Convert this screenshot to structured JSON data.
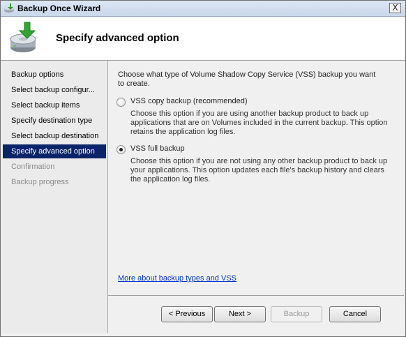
{
  "window": {
    "title": "Backup Once Wizard",
    "close_glyph": "X"
  },
  "header": {
    "heading": "Specify advanced option"
  },
  "steps": [
    {
      "label": "Backup options",
      "state": "normal"
    },
    {
      "label": "Select backup configur...",
      "state": "normal"
    },
    {
      "label": "Select backup items",
      "state": "normal"
    },
    {
      "label": "Specify destination type",
      "state": "normal"
    },
    {
      "label": "Select backup destination",
      "state": "normal"
    },
    {
      "label": "Specify advanced option",
      "state": "active"
    },
    {
      "label": "Confirmation",
      "state": "disabled"
    },
    {
      "label": "Backup progress",
      "state": "disabled"
    }
  ],
  "content": {
    "intro": "Choose what type of Volume Shadow Copy Service (VSS) backup you want to create.",
    "options": [
      {
        "label": "VSS copy backup (recommended)",
        "checked": false,
        "description": "Choose this option if you are using another backup product to back up applications that are on Volumes included in the current backup. This option retains the application log files."
      },
      {
        "label": "VSS full backup",
        "checked": true,
        "description": "Choose this option if you are not using any other backup product to back up your applications. This option updates each file's backup history and clears the application log files."
      }
    ],
    "link": "More about backup types and VSS"
  },
  "buttons": {
    "previous": "< Previous",
    "next": "Next >",
    "backup": "Backup",
    "cancel": "Cancel"
  },
  "icons": {
    "window": "backup-app-icon",
    "header": "backup-disk-icon"
  }
}
